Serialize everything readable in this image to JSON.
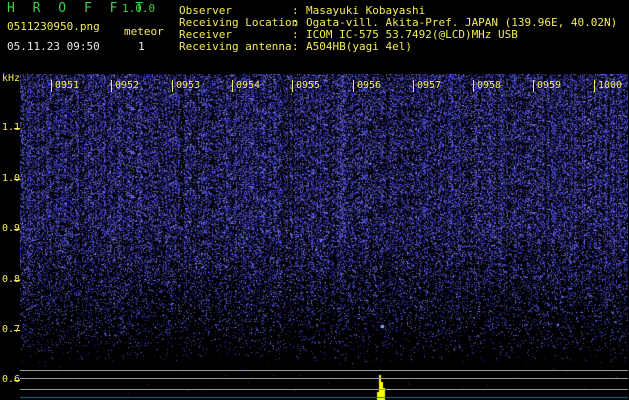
{
  "header": {
    "app_title": "H R O F F T",
    "version": "1.0.0",
    "file_name": "0511230950.png",
    "meteor_label": "meteor",
    "date_time": "05.11.23 09:50",
    "meteor_count": "1"
  },
  "info": [
    {
      "key": "Observer",
      "value": "Masayuki Kobayashi"
    },
    {
      "key": "Receiving Location",
      "value": "Ogata-vill. Akita-Pref. JAPAN (139.96E, 40.02N)"
    },
    {
      "key": "Receiver",
      "value": "ICOM IC-575 53.7492(@LCD)MHz USB"
    },
    {
      "key": "Receiving antenna",
      "value": "A504HB(yagi 4el)"
    }
  ],
  "info_separator": ":",
  "spectrogram": {
    "y_unit": "kHz",
    "y_ticks": [
      "1.1",
      "1.0",
      "0.9",
      "0.8",
      "0.7",
      "0.6"
    ],
    "x_ticks": [
      "0951",
      "0952",
      "0953",
      "0954",
      "0955",
      "0956",
      "0957",
      "0958",
      "0959",
      "1000"
    ],
    "meteor_echo_time": "0956",
    "colors": {
      "background": "#000000",
      "noise": "#3a3ac8",
      "axis_text": "#f4ec5a",
      "header_text": "#39d24a",
      "echo": "#ffff00"
    }
  }
}
